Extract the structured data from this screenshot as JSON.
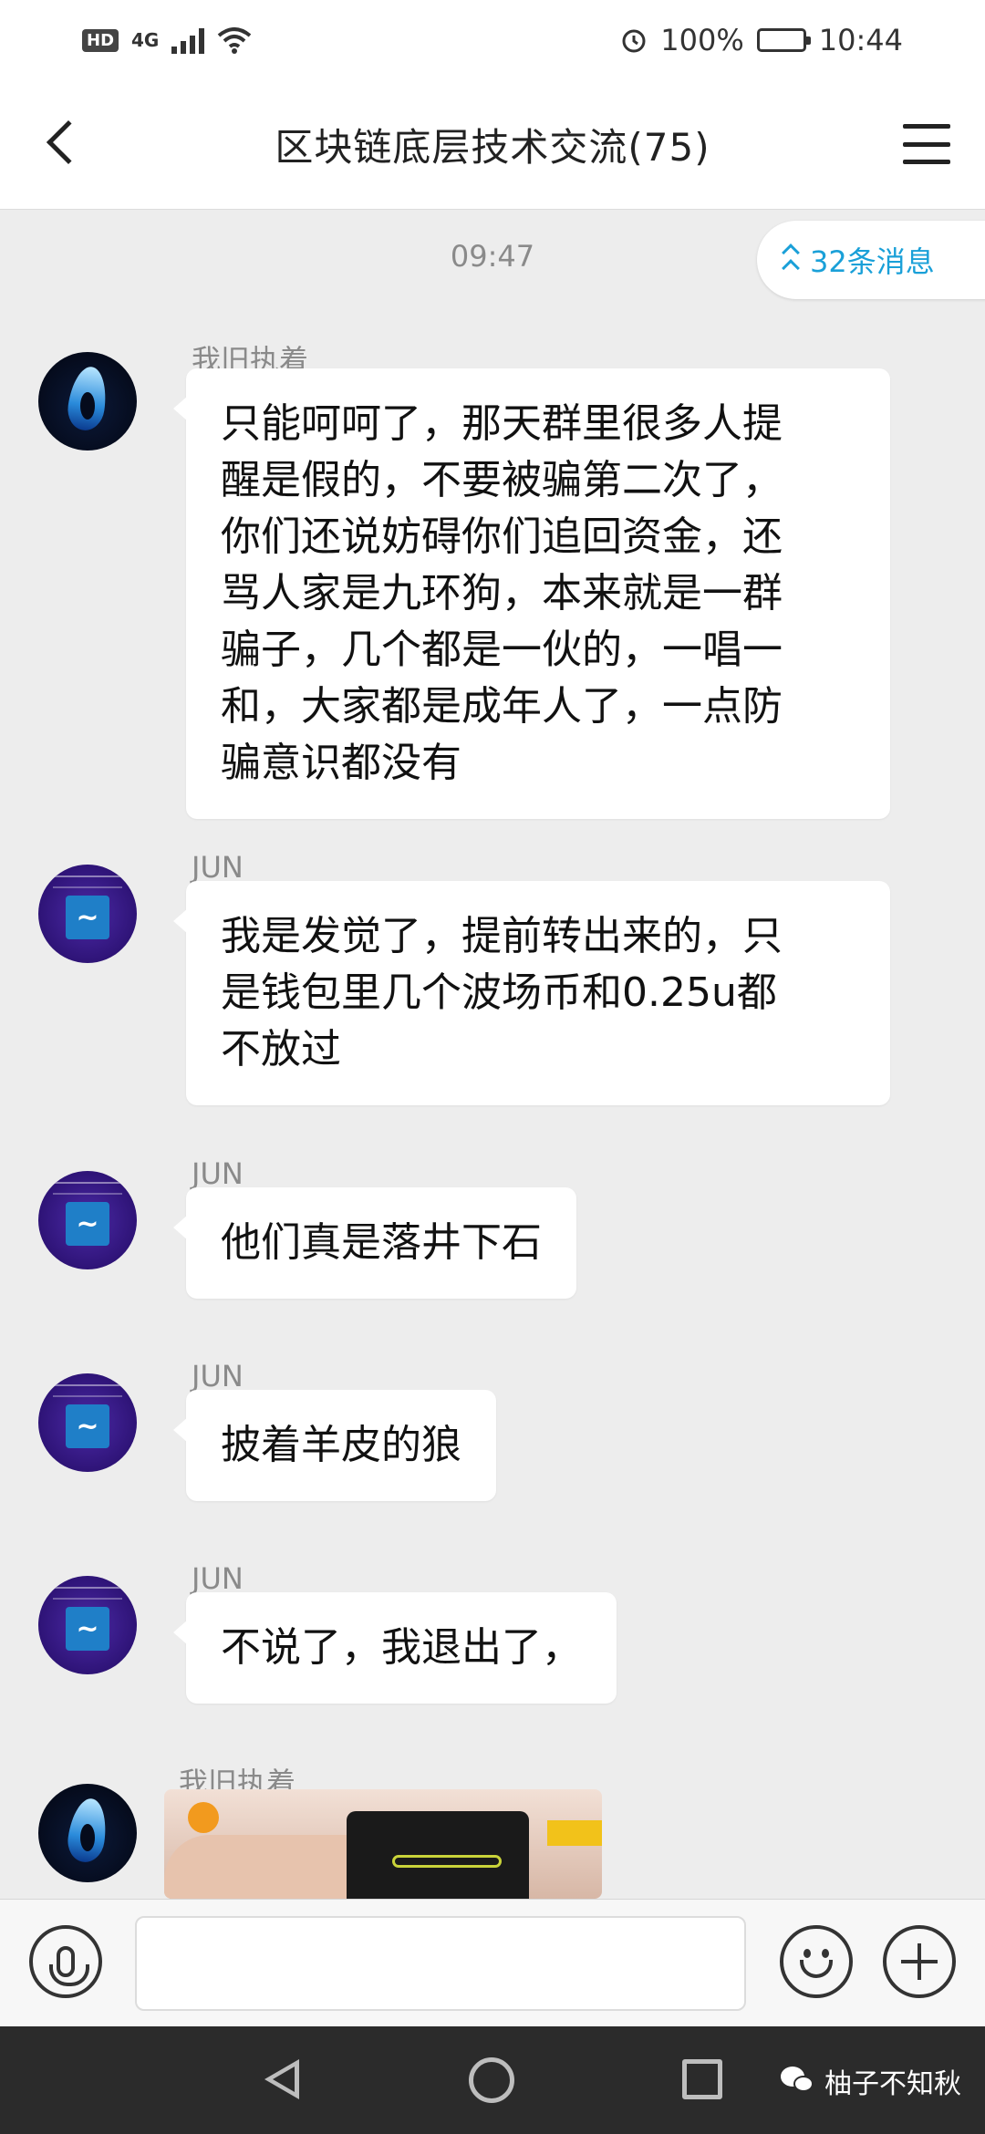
{
  "status_bar": {
    "hd": "HD",
    "network": "4G",
    "battery": "100%",
    "time": "10:44"
  },
  "header": {
    "title": "区块链底层技术交流(75)"
  },
  "chat": {
    "timestamp": "09:47",
    "unread_label": "32条消息",
    "messages": [
      {
        "sender": "我旧执着",
        "avatar": "flame-logo",
        "text": "只能呵呵了，那天群里很多人提\n醒是假的，不要被骗第二次了，\n你们还说妨碍你们追回资金，还\n骂人家是九环狗，本来就是一群\n骗子，几个都是一伙的，一唱一\n和，大家都是成年人了，一点防\n骗意识都没有"
      },
      {
        "sender": "JUN",
        "avatar": "tech-logo",
        "text": "我是发觉了，提前转出来的，只\n是钱包里几个波场币和0.25u都\n不放过"
      },
      {
        "sender": "JUN",
        "avatar": "tech-logo",
        "text": "他们真是落井下石"
      },
      {
        "sender": "JUN",
        "avatar": "tech-logo",
        "text": "披着羊皮的狼"
      },
      {
        "sender": "JUN",
        "avatar": "tech-logo",
        "text": "不说了，我退出了，"
      },
      {
        "sender": "我旧执着",
        "avatar": "flame-logo",
        "image": "video-thumbnail"
      }
    ]
  },
  "input_bar": {
    "text_value": "",
    "icons": [
      "microphone-icon",
      "emoji-icon",
      "plus-icon"
    ]
  },
  "nav_bar": {
    "watermark": "柚子不知秋"
  },
  "colors": {
    "chat_bg": "#ededed",
    "accent": "#1aa0d8",
    "bubble": "#ffffff",
    "nav_bg": "#2b2b2b"
  }
}
